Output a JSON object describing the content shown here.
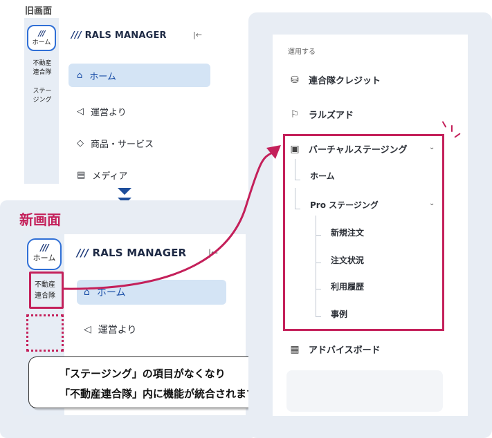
{
  "old_screen": {
    "label": "旧画面",
    "rail": {
      "logo": "///",
      "home": "ホーム",
      "item1": "不動産\n連合隊",
      "item2": "ステー\nジング"
    },
    "brand": {
      "logo": "///",
      "name": "RALS MANAGER"
    },
    "collapse_icon": "|←",
    "nav": [
      {
        "icon": "home-icon",
        "label": "ホーム",
        "active": true
      },
      {
        "icon": "megaphone-icon",
        "label": "運営より",
        "active": false
      },
      {
        "icon": "tag-icon",
        "label": "商品・サービス",
        "active": false
      },
      {
        "icon": "media-icon",
        "label": "メディア",
        "active": false
      }
    ]
  },
  "new_screen": {
    "label": "新画面",
    "rail": {
      "logo": "///",
      "home": "ホーム",
      "item1_line1": "不動産",
      "item1_line2": "連合隊"
    },
    "brand": {
      "logo": "///",
      "name": "RALS MANAGER"
    },
    "collapse_icon": "|←",
    "nav": [
      {
        "icon": "home-icon",
        "label": "ホーム",
        "active": true
      },
      {
        "icon": "megaphone-icon",
        "label": "運営より",
        "active": false
      }
    ]
  },
  "callout": {
    "line1": "「ステージング」の項目がなくなり",
    "line2": "「不動産連合隊」内に機能が統合されます"
  },
  "menu": {
    "section_label": "運用する",
    "items": [
      {
        "icon": "coins-icon",
        "label": "連合隊クレジット"
      },
      {
        "icon": "flag-icon",
        "label": "ラルズアド"
      },
      {
        "icon": "image-icon",
        "label": "バーチャルステージング"
      }
    ],
    "sub_home": "ホーム",
    "sub_pro": "Pro ステージング",
    "pro_children": [
      "新規注文",
      "注文状況",
      "利用履歴",
      "事例"
    ],
    "advice": {
      "icon": "clipboard-icon",
      "label": "アドバイスボード"
    }
  },
  "colors": {
    "accent": "#c4205a",
    "active_bg": "#d4e4f5",
    "arrow": "#1e4e9b",
    "panel_bg": "#e8edf4"
  }
}
